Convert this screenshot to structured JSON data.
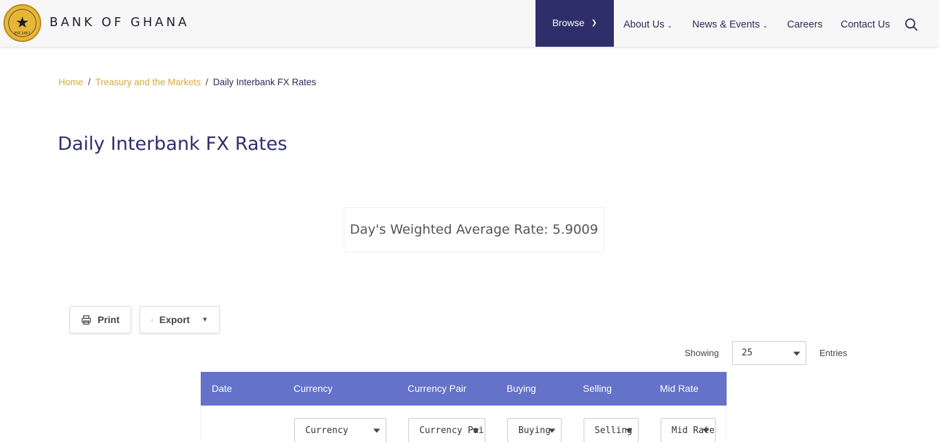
{
  "header": {
    "brand": "BANK OF GHANA",
    "logo_est": "EST.1957",
    "nav": {
      "browse": "Browse",
      "about": "About Us",
      "news": "News & Events",
      "careers": "Careers",
      "contact": "Contact Us"
    }
  },
  "breadcrumb": {
    "home": "Home",
    "section": "Treasury and the Markets",
    "current": "Daily Interbank FX Rates",
    "separator": "/"
  },
  "page": {
    "title": "Daily Interbank FX Rates",
    "weighted_average": "Day's Weighted Average Rate: 5.9009"
  },
  "toolbar": {
    "print": "Print",
    "export": "Export"
  },
  "entries": {
    "showing": "Showing",
    "value": "25",
    "label": "Entries"
  },
  "table": {
    "columns": [
      "Date",
      "Currency",
      "Currency Pair",
      "Buying",
      "Selling",
      "Mid Rate"
    ],
    "filters": [
      "Currency",
      "Currency Pair",
      "Buying",
      "Selling",
      "Mid Rate"
    ]
  },
  "colors": {
    "navy": "#2e2e6b",
    "gold": "#d9a93a",
    "table_header": "#6472c8"
  }
}
